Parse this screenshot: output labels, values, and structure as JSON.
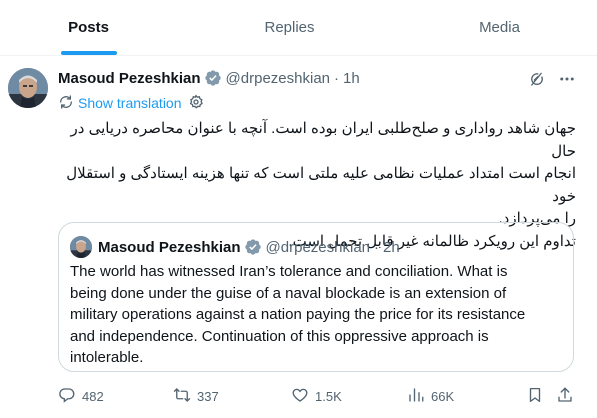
{
  "tabs": [
    {
      "label": "Posts",
      "active": true
    },
    {
      "label": "Replies",
      "active": false
    },
    {
      "label": "Media",
      "active": false
    }
  ],
  "post": {
    "author_name": "Masoud Pezeshkian",
    "handle": "@drpezeshkian",
    "separator": "·",
    "time": "1h",
    "show_translation": "Show translation",
    "text_lines": [
      "جهان شاهد رواداری و صلح‌طلبی ایران بوده است. آنچه با عنوان محاصره دریایی در حال",
      "انجام است امتداد عملیات نظامی علیه ملتی است که تنها هزینه ایستادگی و استقلال خود",
      "را می‌پردازد.",
      "تداوم این رویکرد ظالمانه غیر قابل تحمل است."
    ]
  },
  "quote": {
    "author_name": "Masoud Pezeshkian",
    "handle": "@drpezeshkian",
    "separator": "·",
    "time": "2h",
    "text_lines": [
      "The world has witnessed Iran’s tolerance and conciliation. What is",
      "being done under the guise of a naval blockade is an extension of",
      "military operations against a nation paying the price for its resistance",
      "and independence. Continuation of this oppressive approach is",
      "intolerable."
    ]
  },
  "actions": {
    "replies": "482",
    "reposts": "337",
    "likes": "1.5K",
    "views": "66K"
  },
  "icons": [
    "verified-badge-icon",
    "grok-icon",
    "more-icon",
    "translate-icon",
    "gear-icon",
    "reply-icon",
    "repost-icon",
    "like-icon",
    "views-icon",
    "bookmark-icon",
    "share-icon"
  ],
  "colors": {
    "accent": "#1d9bf0",
    "text_primary": "#0f1419",
    "text_secondary": "#536471",
    "border": "#cfd9de"
  }
}
